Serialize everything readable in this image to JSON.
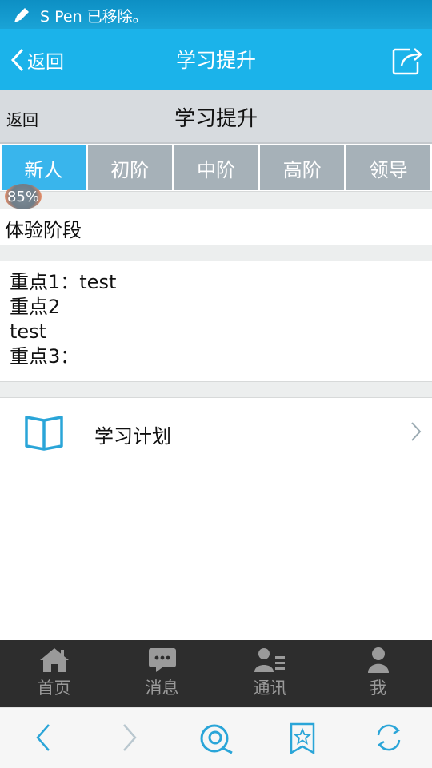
{
  "status_bar": {
    "notification": "S Pen 已移除。"
  },
  "title_bar": {
    "back_label": "返回",
    "title": "学习提升"
  },
  "sub_header": {
    "back_label": "返回",
    "title": "学习提升"
  },
  "level_tabs": [
    {
      "label": "新人",
      "active": true
    },
    {
      "label": "初阶",
      "active": false
    },
    {
      "label": "中阶",
      "active": false
    },
    {
      "label": "高阶",
      "active": false
    },
    {
      "label": "领导",
      "active": false
    }
  ],
  "progress": {
    "label": "85%",
    "value": 0.85
  },
  "stage": {
    "title": "体验阶段"
  },
  "key_points": [
    "重点1：test",
    "重点2",
    "test",
    "重点3："
  ],
  "plan_row": {
    "label": "学习计划",
    "icon": "book-icon"
  },
  "bottom_nav": [
    {
      "label": "首页",
      "icon": "home-icon"
    },
    {
      "label": "消息",
      "icon": "message-icon"
    },
    {
      "label": "通讯",
      "icon": "contacts-icon"
    },
    {
      "label": "我",
      "icon": "person-icon"
    }
  ],
  "colors": {
    "primary": "#1bb3ea",
    "tab_active": "#39b5ec",
    "tab_inactive": "#a6b1b8",
    "nav_bg": "#2d2d2d",
    "icon_blue": "#2aa5d8"
  }
}
